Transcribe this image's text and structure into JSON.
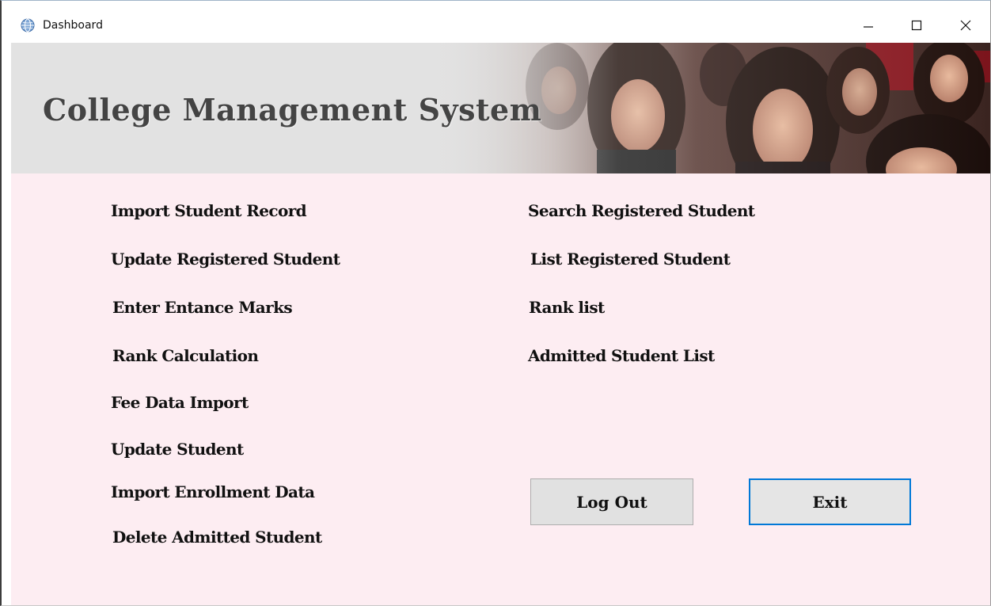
{
  "window": {
    "title": "Dashboard",
    "app_icon": "globe-icon",
    "controls": {
      "minimize_icon": "minimize-icon",
      "maximize_icon": "maximize-icon",
      "close_icon": "close-icon"
    }
  },
  "banner": {
    "title": "College Management System",
    "image": "students-photo"
  },
  "menu": {
    "left": [
      {
        "label": "Import Student Record"
      },
      {
        "label": "Update Registered Student"
      },
      {
        "label": "Enter Entance Marks"
      },
      {
        "label": "Rank Calculation"
      },
      {
        "label": "Fee Data Import"
      },
      {
        "label": "Update Student"
      },
      {
        "label": "Import Enrollment Data"
      },
      {
        "label": "Delete Admitted Student"
      }
    ],
    "right": [
      {
        "label": "Search Registered Student"
      },
      {
        "label": "List Registered Student"
      },
      {
        "label": "Rank list"
      },
      {
        "label": "Admitted Student List"
      }
    ]
  },
  "actions": {
    "logout_label": "Log Out",
    "exit_label": "Exit"
  },
  "colors": {
    "content_background": "#fdedf2",
    "focus_border": "#0078d7",
    "button_face": "#e1e1e1"
  }
}
